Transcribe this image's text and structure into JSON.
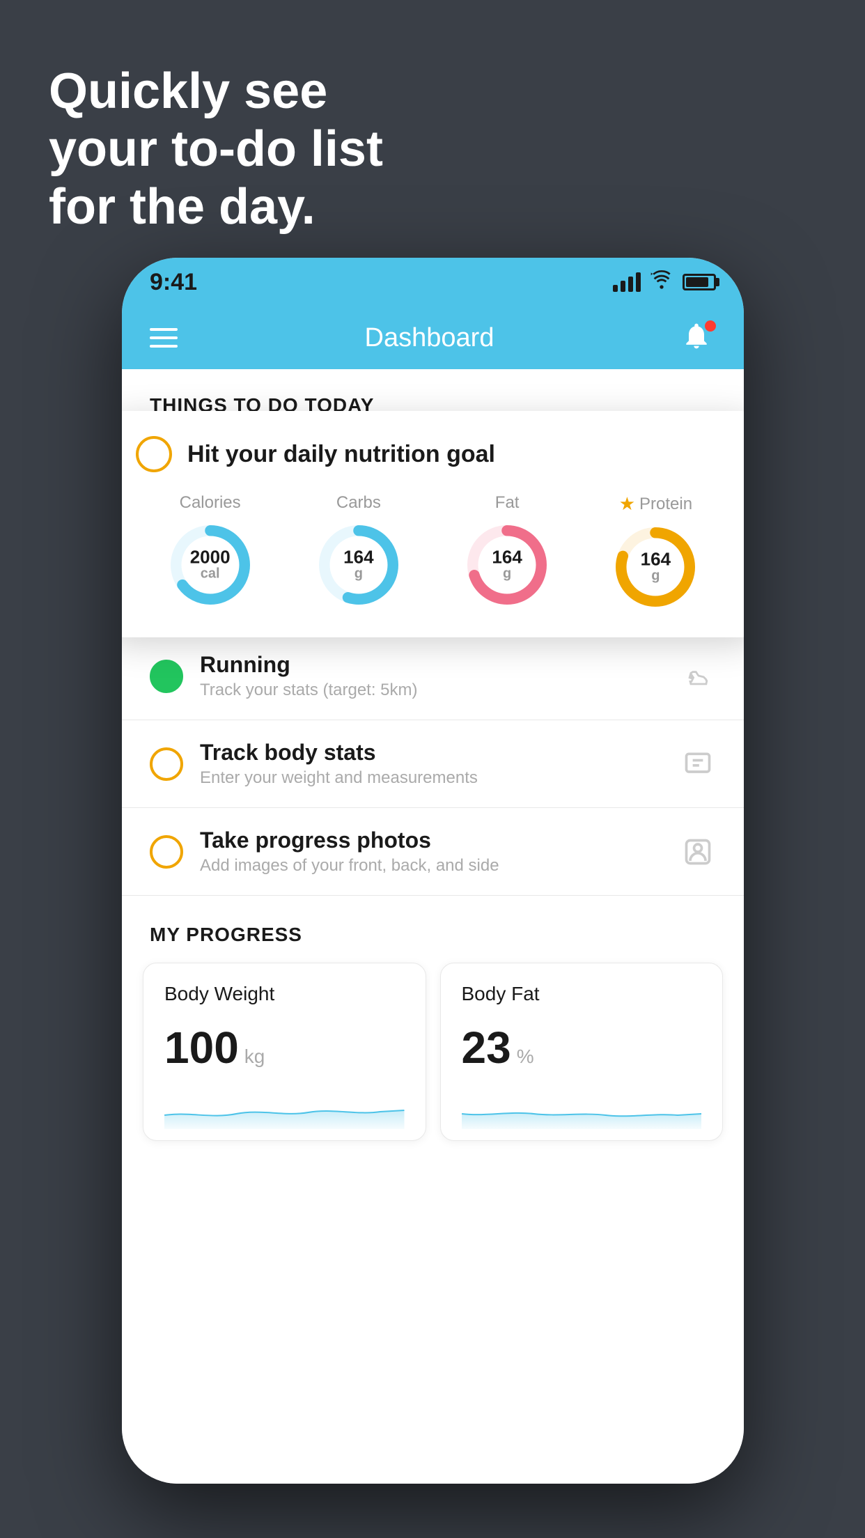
{
  "headline": {
    "line1": "Quickly see",
    "line2": "your to-do list",
    "line3": "for the day."
  },
  "status_bar": {
    "time": "9:41"
  },
  "nav": {
    "title": "Dashboard"
  },
  "things_today": {
    "section_label": "THINGS TO DO TODAY"
  },
  "floating_card": {
    "title": "Hit your daily nutrition goal",
    "nutrition": [
      {
        "label": "Calories",
        "value": "2000",
        "unit": "cal",
        "color": "#4dc3e8",
        "percent": 65
      },
      {
        "label": "Carbs",
        "value": "164",
        "unit": "g",
        "color": "#4dc3e8",
        "percent": 55
      },
      {
        "label": "Fat",
        "value": "164",
        "unit": "g",
        "color": "#f06e8a",
        "percent": 70
      },
      {
        "label": "Protein",
        "value": "164",
        "unit": "g",
        "color": "#f0a500",
        "percent": 80,
        "starred": true
      }
    ]
  },
  "todo_items": [
    {
      "name": "Running",
      "desc": "Track your stats (target: 5km)",
      "icon": "shoe",
      "circle_color": "green"
    },
    {
      "name": "Track body stats",
      "desc": "Enter your weight and measurements",
      "icon": "scale",
      "circle_color": "yellow"
    },
    {
      "name": "Take progress photos",
      "desc": "Add images of your front, back, and side",
      "icon": "person",
      "circle_color": "yellow"
    }
  ],
  "progress": {
    "section_label": "MY PROGRESS",
    "cards": [
      {
        "title": "Body Weight",
        "value": "100",
        "unit": "kg"
      },
      {
        "title": "Body Fat",
        "value": "23",
        "unit": "%"
      }
    ]
  }
}
